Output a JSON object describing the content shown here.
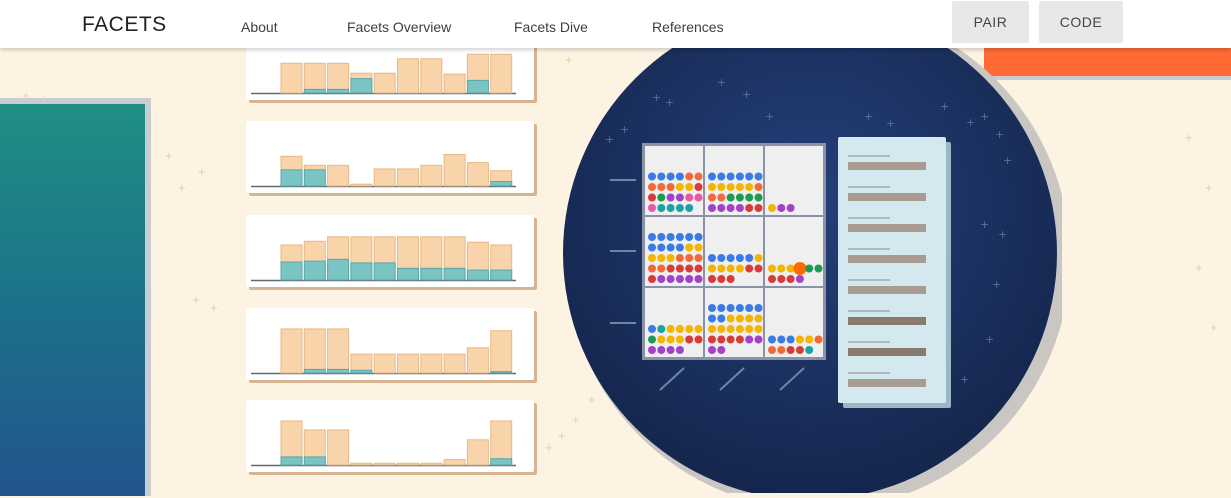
{
  "header": {
    "logo": "FACETS",
    "nav": [
      "About",
      "Facets Overview",
      "Facets Dive",
      "References"
    ],
    "buttons": [
      "PAIR",
      "CODE"
    ]
  },
  "colors": {
    "page_bg": "#fdf3e3",
    "bar_fill": "#f9d3a9",
    "bar_highlight": "#7bc4c4",
    "circle": "#1e3568",
    "orange_accent": "#ff6a33"
  },
  "histograms": [
    {
      "bars": [
        0.66,
        0.66,
        0.66,
        0.44,
        0.44,
        0.76,
        0.76,
        0.42,
        0.86,
        0.86
      ],
      "overlay": [
        0,
        0.08,
        0.08,
        0.32,
        0,
        0,
        0,
        0,
        0.28,
        0
      ]
    },
    {
      "bars": [
        0.66,
        0.46,
        0.46,
        0.04,
        0.38,
        0.38,
        0.46,
        0.7,
        0.52,
        0.34
      ],
      "overlay": [
        0.36,
        0.36,
        0,
        0,
        0,
        0,
        0,
        0,
        0,
        0.1
      ]
    },
    {
      "bars": [
        0.78,
        0.86,
        0.96,
        0.96,
        0.96,
        0.96,
        0.96,
        0.96,
        0.84,
        0.78
      ],
      "overlay": [
        0.4,
        0.42,
        0.46,
        0.38,
        0.38,
        0.26,
        0.26,
        0.26,
        0.22,
        0.22
      ]
    },
    {
      "bars": [
        0.98,
        0.98,
        0.98,
        0.42,
        0.42,
        0.42,
        0.42,
        0.42,
        0.56,
        0.94
      ],
      "overlay": [
        0,
        0.08,
        0.08,
        0.06,
        0,
        0,
        0,
        0,
        0,
        0.03
      ]
    },
    {
      "bars": [
        0.98,
        0.78,
        0.78,
        0.04,
        0.04,
        0.04,
        0.04,
        0.12,
        0.56,
        0.98
      ],
      "overlay": [
        0.18,
        0.18,
        0,
        0,
        0,
        0,
        0,
        0,
        0,
        0.14
      ]
    }
  ],
  "dive": {
    "cells": [
      [
        {
          "n": 23,
          "c": [
            "b",
            "b",
            "b",
            "b",
            "o",
            "o",
            "o",
            "o",
            "o",
            "y",
            "y",
            "r",
            "r",
            "g",
            "p",
            "p",
            "k",
            "k",
            "k",
            "t",
            "t",
            "t",
            "t"
          ]
        },
        {
          "n": 24,
          "c": [
            "b",
            "b",
            "b",
            "b",
            "b",
            "b",
            "y",
            "y",
            "y",
            "y",
            "y",
            "o",
            "o",
            "o",
            "g",
            "g",
            "g",
            "g",
            "p",
            "p",
            "p",
            "p",
            "r",
            "r"
          ]
        },
        {
          "n": 3,
          "c": [
            "y",
            "p",
            "p"
          ]
        }
      ],
      [
        {
          "n": 30,
          "c": [
            "b",
            "b",
            "b",
            "b",
            "b",
            "b",
            "b",
            "b",
            "b",
            "b",
            "y",
            "y",
            "y",
            "y",
            "y",
            "o",
            "o",
            "o",
            "o",
            "o",
            "r",
            "r",
            "r",
            "r",
            "r",
            "p",
            "p",
            "p",
            "p",
            "p"
          ]
        },
        {
          "n": 15,
          "c": [
            "b",
            "b",
            "b",
            "b",
            "b",
            "y",
            "y",
            "y",
            "y",
            "y",
            "r",
            "r",
            "r",
            "r",
            "r"
          ]
        },
        {
          "n": 10,
          "c": [
            "y",
            "y",
            "y",
            "O",
            "g",
            "g",
            "r",
            "r",
            "r",
            "p"
          ]
        }
      ],
      [
        {
          "n": 16,
          "c": [
            "b",
            "t",
            "y",
            "y",
            "y",
            "y",
            "g",
            "y",
            "y",
            "y",
            "r",
            "r",
            "p",
            "p",
            "p",
            "p"
          ]
        },
        {
          "n": 26,
          "c": [
            "b",
            "b",
            "b",
            "b",
            "b",
            "b",
            "b",
            "b",
            "y",
            "y",
            "y",
            "y",
            "y",
            "y",
            "y",
            "y",
            "y",
            "y",
            "r",
            "r",
            "r",
            "r",
            "p",
            "p",
            "p",
            "p"
          ]
        },
        {
          "n": 11,
          "c": [
            "b",
            "b",
            "b",
            "y",
            "y",
            "o",
            "o",
            "o",
            "r",
            "r",
            "t"
          ]
        }
      ]
    ],
    "dot_colors": {
      "b": "#3b7be8",
      "o": "#f26a3a",
      "y": "#f4b400",
      "r": "#d93b3b",
      "g": "#1e9a4f",
      "p": "#a142c8",
      "k": "#e85aa0",
      "t": "#19a3a3",
      "O": "#ff6a00"
    },
    "panel_rows": 8
  }
}
